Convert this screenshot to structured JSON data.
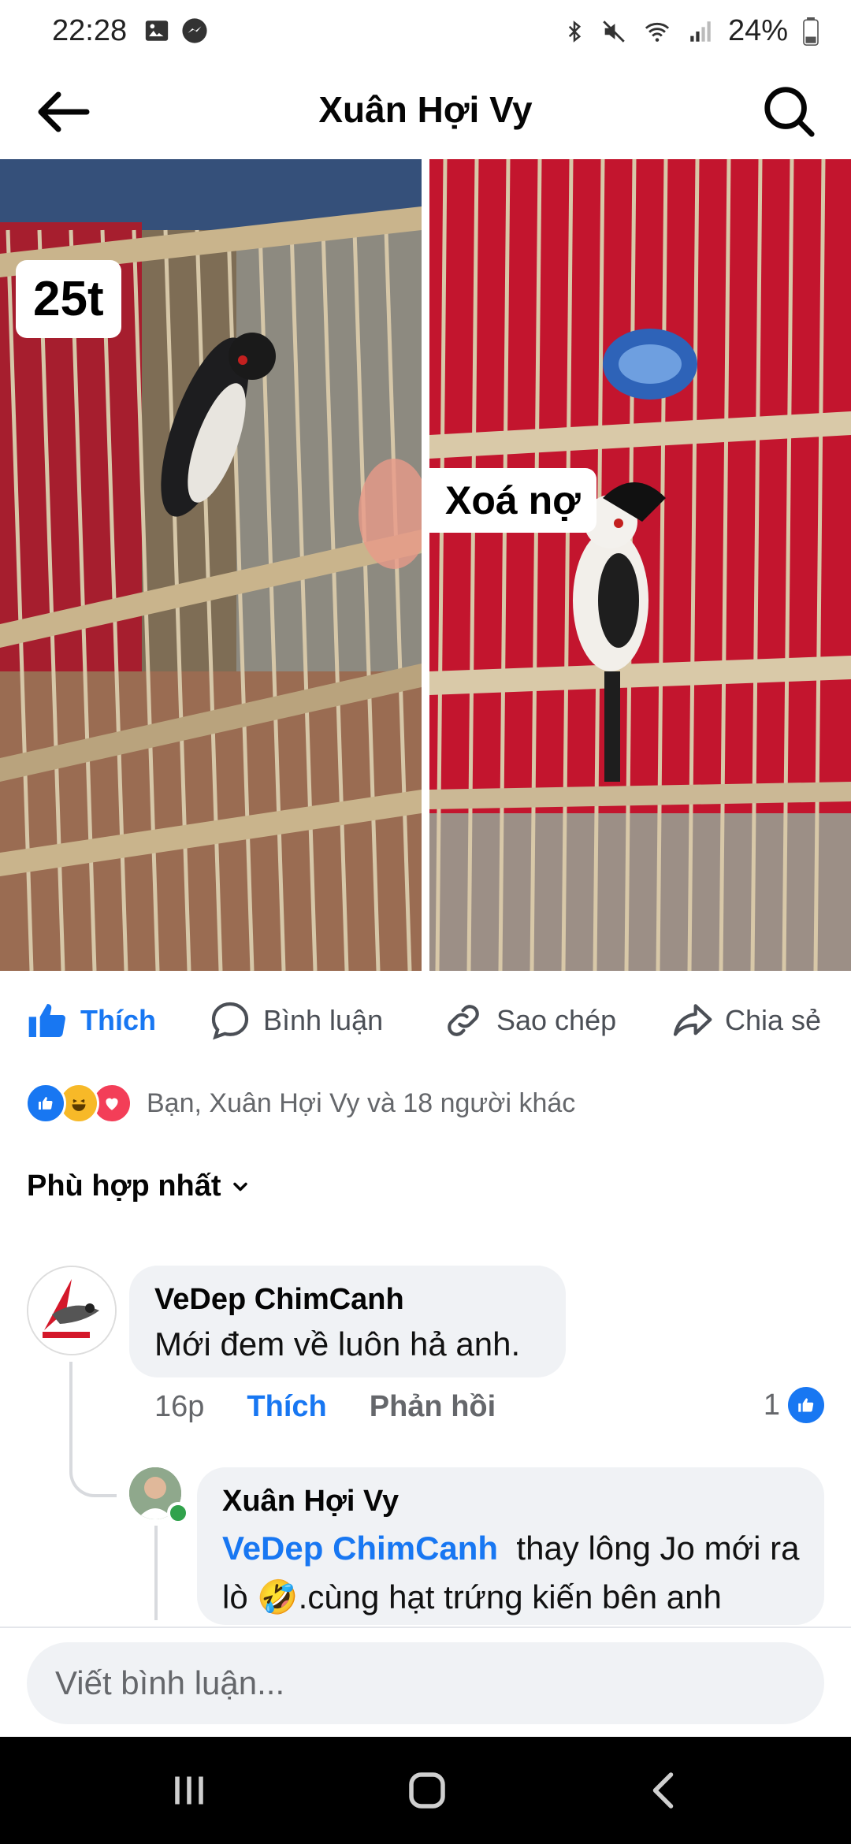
{
  "status_bar": {
    "time": "22:28",
    "battery": "24%",
    "left_icons": [
      "image-icon",
      "messenger-icon"
    ],
    "right_icons": [
      "bluetooth-icon",
      "mute-icon",
      "wifi-icon",
      "signal-icon",
      "battery-icon"
    ]
  },
  "header": {
    "title": "Xuân Hợi Vy"
  },
  "photos": [
    {
      "tag": "25t"
    },
    {
      "tag": "Xoá nợ"
    }
  ],
  "actions": {
    "like": "Thích",
    "comment": "Bình luận",
    "copy": "Sao chép",
    "share": "Chia sẻ"
  },
  "reactions": {
    "text": "Bạn, Xuân Hợi Vy và 18 người khác",
    "icons": [
      "like-reaction-icon",
      "haha-reaction-icon",
      "love-reaction-icon"
    ]
  },
  "sort": {
    "label": "Phù hợp nhất"
  },
  "comments": [
    {
      "author": "VeDep ChimCanh",
      "text": "Mới đem về luôn hả anh.",
      "time": "16p",
      "like_label": "Thích",
      "reply_label": "Phản hồi",
      "like_count": "1"
    },
    {
      "author": "Xuân Hợi Vy",
      "mention": "VeDep ChimCanh",
      "text_part1": "thay lông Jo mới ra lò ",
      "emoji": "🤣",
      "text_part2": ".cùng hạt trứng kiến bên anh"
    }
  ],
  "composer": {
    "placeholder": "Viết bình luận..."
  },
  "colors": {
    "accent": "#1877f2",
    "bubble": "#f0f2f5",
    "muted": "#65676b"
  }
}
